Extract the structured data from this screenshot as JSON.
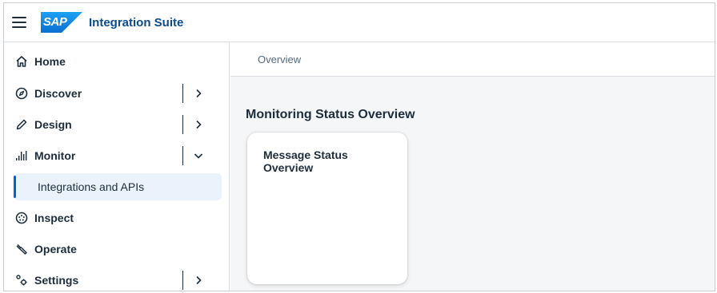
{
  "shell": {
    "product_title": "Integration Suite",
    "logo_text": "SAP",
    "brand_color": "#0a6ed1",
    "menu_icon": "hamburger-icon"
  },
  "sidebar": {
    "items": [
      {
        "label": "Home",
        "icon": "home-icon",
        "has_children": false
      },
      {
        "label": "Discover",
        "icon": "compass-icon",
        "has_children": true,
        "expanded": false
      },
      {
        "label": "Design",
        "icon": "pencil-icon",
        "has_children": true,
        "expanded": false
      },
      {
        "label": "Monitor",
        "icon": "bar-chart-icon",
        "has_children": true,
        "expanded": true
      },
      {
        "label": "Inspect",
        "icon": "inspect-icon",
        "has_children": false
      },
      {
        "label": "Operate",
        "icon": "wrench-icon",
        "has_children": false
      },
      {
        "label": "Settings",
        "icon": "settings-icon",
        "has_children": true,
        "expanded": false
      }
    ],
    "monitor_children": [
      {
        "label": "Integrations and APIs",
        "selected": true
      }
    ],
    "selection_color": "#0064d9"
  },
  "main": {
    "breadcrumb": "Overview",
    "section_title": "Monitoring Status Overview",
    "card_title": "Message Status Overview"
  }
}
